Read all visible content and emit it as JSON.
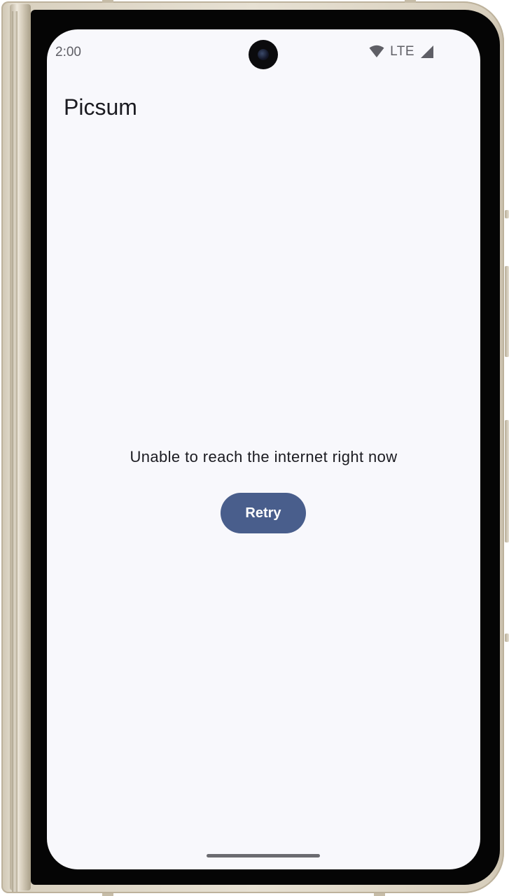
{
  "status_bar": {
    "time": "2:00",
    "network_label": "LTE",
    "icons": [
      "wifi-icon",
      "signal-icon"
    ]
  },
  "app_bar": {
    "title": "Picsum"
  },
  "error_state": {
    "message": "Unable to reach the internet right now",
    "retry_label": "Retry"
  },
  "colors": {
    "background": "#f8f8fc",
    "primary_button": "#495e8c",
    "button_text": "#ffffff",
    "text": "#1b1b21"
  }
}
